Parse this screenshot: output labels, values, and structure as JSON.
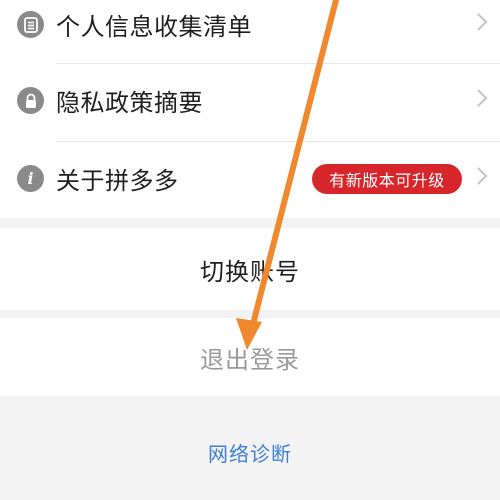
{
  "settings": {
    "items": [
      {
        "label": "个人信息收集清单",
        "icon": "document-list-icon"
      },
      {
        "label": "隐私政策摘要",
        "icon": "lock-icon"
      },
      {
        "label": "关于拼多多",
        "icon": "info-icon",
        "badge": "有新版本可升级"
      }
    ]
  },
  "actions": {
    "switch_account": "切换账号",
    "logout": "退出登录",
    "network_diagnose": "网络诊断"
  },
  "colors": {
    "badge_bg": "#d6262c",
    "link": "#3f7fd6",
    "arrow": "#f0892e",
    "logout_text": "#9a9a9a"
  }
}
